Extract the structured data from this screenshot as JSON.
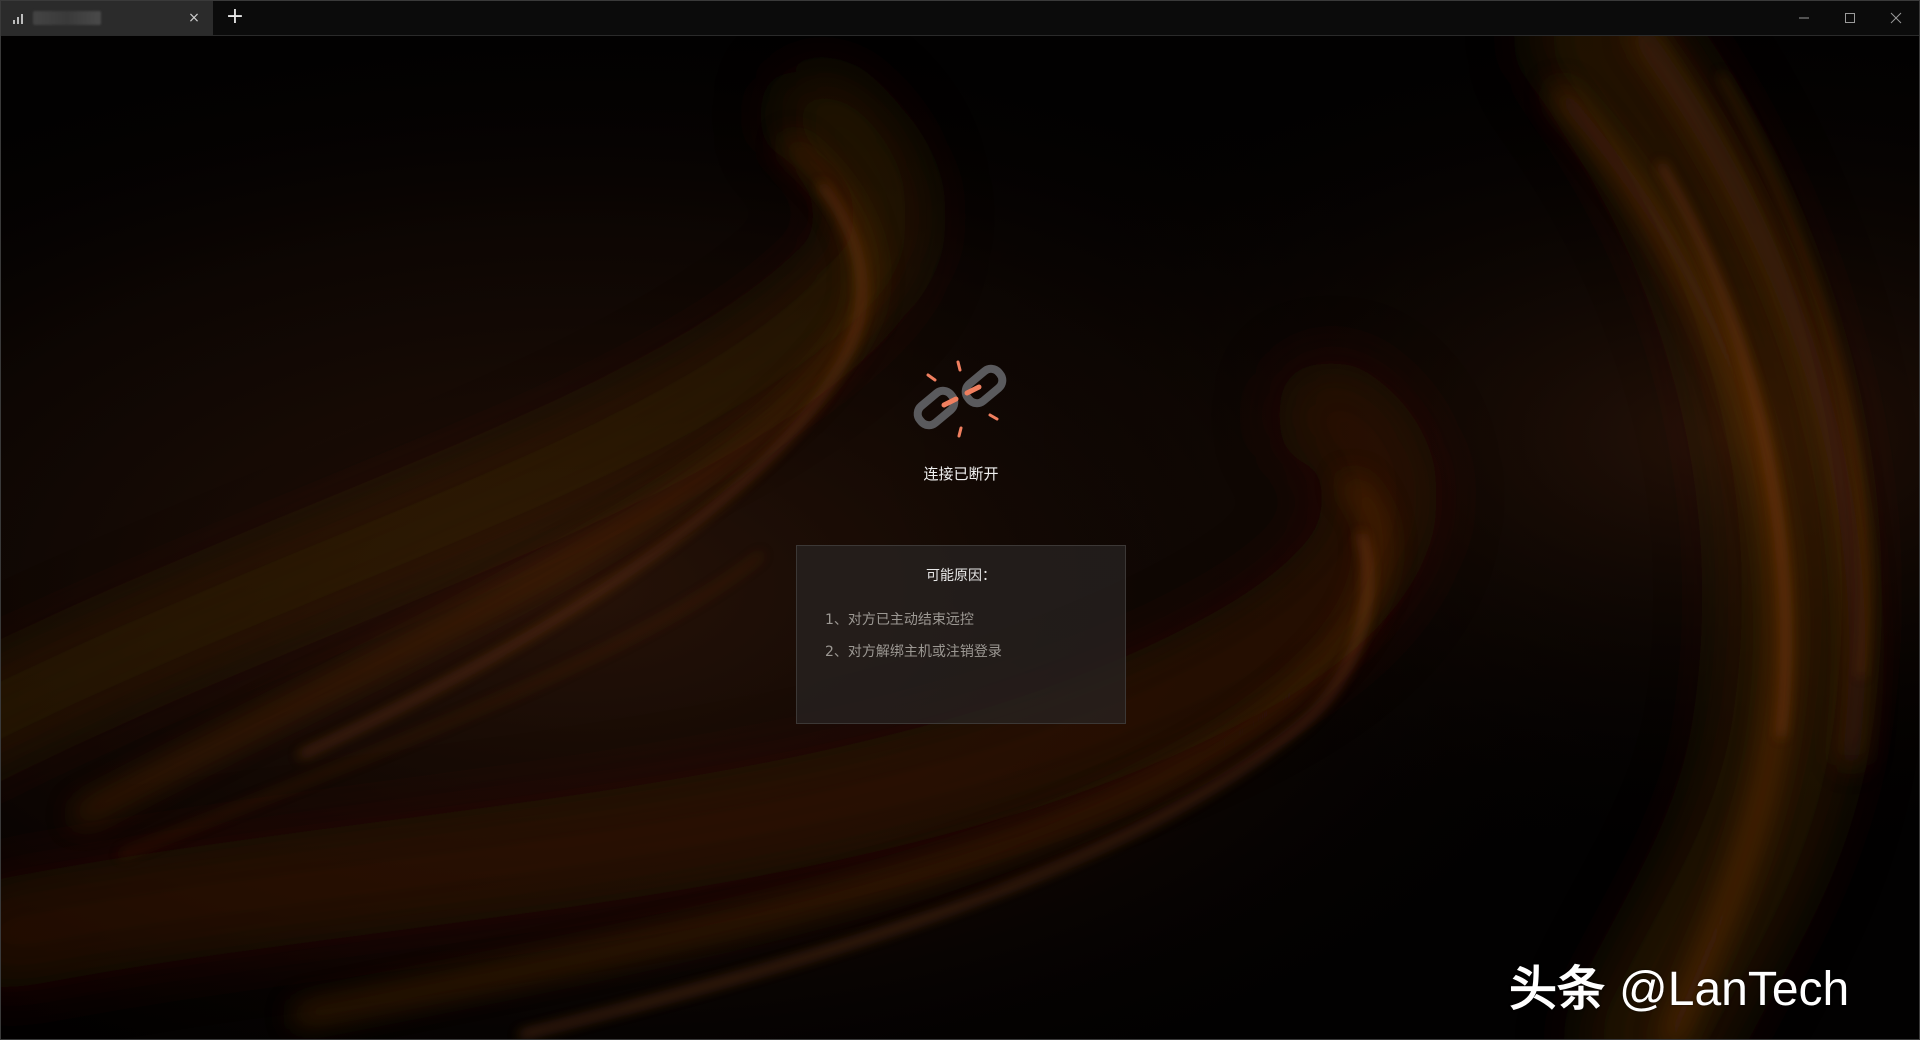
{
  "tab": {
    "title": "",
    "close_glyph": "×"
  },
  "tabbar": {
    "add_glyph": "+"
  },
  "window_controls": {
    "minimize": "–",
    "maximize": "□",
    "close": "✕"
  },
  "connection": {
    "icon": "broken-link-icon",
    "status": "连接已断开"
  },
  "reasons": {
    "title": "可能原因：",
    "items": [
      "1、对方已主动结束远控",
      "2、对方解绑主机或注销登录"
    ]
  },
  "watermark": {
    "brand": "头条",
    "handle": "@LanTech"
  },
  "colors": {
    "accent": "#f07f5f",
    "link_gray": "#5a5a5d",
    "background": "#000000",
    "swirl": "#c2622a"
  }
}
